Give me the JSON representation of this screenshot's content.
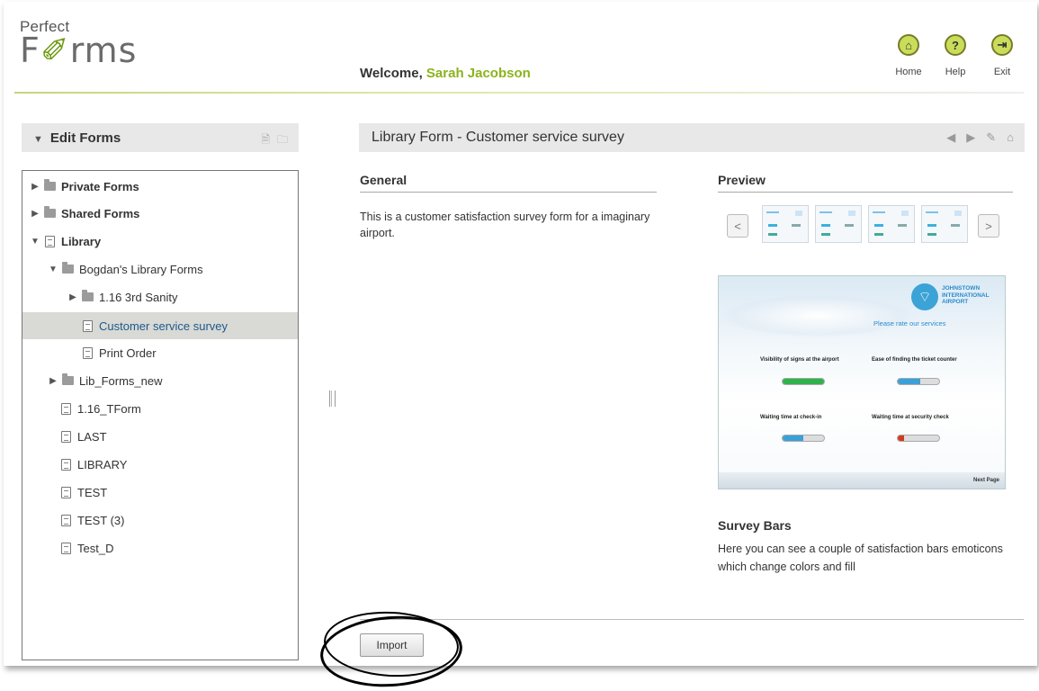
{
  "app": {
    "logo_top": "Perfect",
    "logo_f": "F",
    "logo_rest": "rms"
  },
  "header": {
    "welcome_prefix": "Welcome,",
    "user_name": "Sarah Jacobson",
    "nav": [
      {
        "label": "Home",
        "icon": "home-icon"
      },
      {
        "label": "Help",
        "icon": "help-icon"
      },
      {
        "label": "Exit",
        "icon": "exit-icon"
      }
    ]
  },
  "sidebar": {
    "title": "Edit Forms",
    "tree": [
      {
        "label": "Private Forms",
        "type": "root",
        "expanded": false
      },
      {
        "label": "Shared Forms",
        "type": "root",
        "expanded": false
      },
      {
        "label": "Library",
        "type": "root",
        "expanded": true
      },
      {
        "label": "Bogdan's Library Forms",
        "type": "folder",
        "expanded": true
      },
      {
        "label": "1.16 3rd Sanity",
        "type": "folder",
        "expanded": false
      },
      {
        "label": "Customer service survey",
        "type": "form",
        "selected": true
      },
      {
        "label": "Print Order",
        "type": "form"
      },
      {
        "label": "Lib_Forms_new",
        "type": "folder",
        "expanded": false
      },
      {
        "label": "1.16_TForm",
        "type": "form"
      },
      {
        "label": "LAST",
        "type": "form"
      },
      {
        "label": "LIBRARY",
        "type": "form"
      },
      {
        "label": "TEST",
        "type": "form"
      },
      {
        "label": "TEST (3)",
        "type": "form"
      },
      {
        "label": "Test_D",
        "type": "form"
      }
    ]
  },
  "main": {
    "title": "Library Form - Customer service survey",
    "general_title": "General",
    "general_desc": "This is a customer satisfaction survey form for a imaginary airport.",
    "preview_title": "Preview",
    "carousel_prev": "<",
    "carousel_next": ">",
    "preview": {
      "airport_name": "JOHNSTOWN INTERNATIONAL AIRPORT",
      "rate_text": "Please rate our services",
      "questions": [
        "Visibility of signs at the airport",
        "Ease of finding the ticket counter",
        "Waiting time at check-in",
        "Waiting time at security check"
      ],
      "levels": [
        1.0,
        0.55,
        0.5,
        0.15
      ],
      "level_colors": [
        "#2db34a",
        "#3aa0d8",
        "#3aa0d8",
        "#d23a1e"
      ],
      "next_label": "Next Page"
    },
    "section_title": "Survey Bars",
    "section_desc": "Here you can see a couple of satisfaction bars emoticons which change colors and fill",
    "import_label": "Import"
  }
}
